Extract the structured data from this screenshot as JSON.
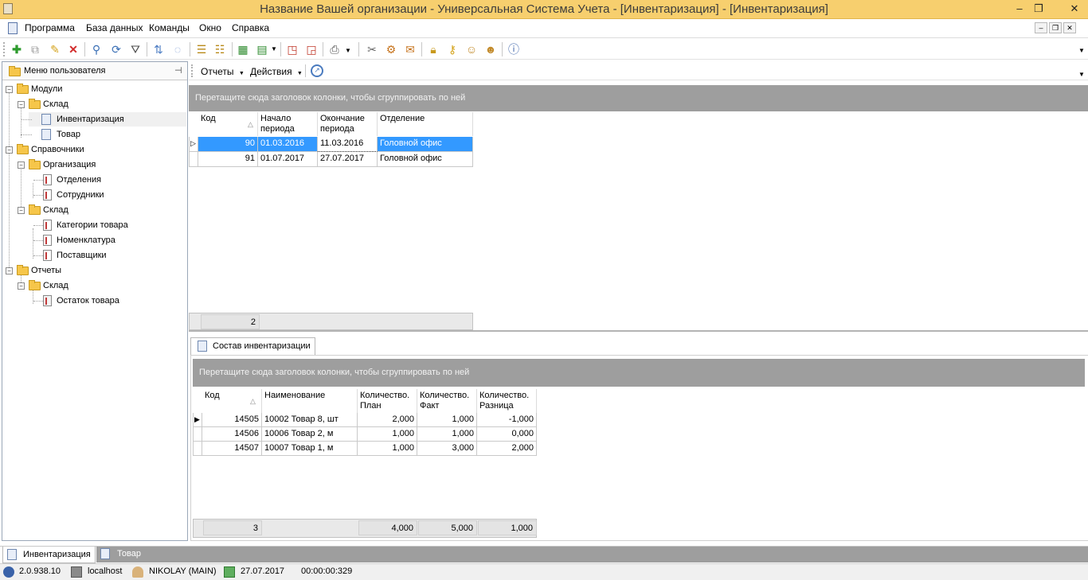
{
  "window": {
    "title": "Название Вашей организации - Универсальная Система Учета - [Инвентаризация] - [Инвентаризация]",
    "minimize": "‒",
    "restore": "❐",
    "close": "✕"
  },
  "menu": {
    "items": [
      "Программа",
      "База данных",
      "Команды",
      "Окно",
      "Справка"
    ]
  },
  "left_panel": {
    "title": "Меню пользователя",
    "pin": "⊣",
    "tree": [
      {
        "label": "Модули",
        "type": "folder"
      },
      {
        "label": "Склад",
        "type": "folder"
      },
      {
        "label": "Инвентаризация",
        "type": "doc"
      },
      {
        "label": "Товар",
        "type": "doc"
      },
      {
        "label": "Справочники",
        "type": "folder"
      },
      {
        "label": "Организация",
        "type": "folder"
      },
      {
        "label": "Отделения",
        "type": "ref"
      },
      {
        "label": "Сотрудники",
        "type": "ref"
      },
      {
        "label": "Склад",
        "type": "folder"
      },
      {
        "label": "Категории товара",
        "type": "ref"
      },
      {
        "label": "Номенклатура",
        "type": "ref"
      },
      {
        "label": "Поставщики",
        "type": "ref"
      },
      {
        "label": "Отчеты",
        "type": "folder"
      },
      {
        "label": "Склад",
        "type": "folder"
      },
      {
        "label": "Остаток товара",
        "type": "report"
      }
    ]
  },
  "sub_toolbar": {
    "reports": "Отчеты",
    "actions": "Действия"
  },
  "top_grid": {
    "group_hint": "Перетащите сюда заголовок колонки, чтобы сгруппировать по ней",
    "headers": [
      "Код",
      "Начало периода",
      "Окончание периода",
      "Отделение"
    ],
    "rows": [
      [
        "90",
        "01.03.2016",
        "11.03.2016",
        "Головной офис"
      ],
      [
        "91",
        "01.07.2017",
        "27.07.2017",
        "Головной офис"
      ]
    ],
    "footer_count": "2"
  },
  "detail_tab": {
    "label": "Состав инвентаризации"
  },
  "bottom_grid": {
    "group_hint": "Перетащите сюда заголовок колонки, чтобы сгруппировать по ней",
    "headers": [
      "Код",
      "Наименование",
      "Количество. План",
      "Количество. Факт",
      "Количество. Разница"
    ],
    "rows": [
      [
        "14505",
        "10002 Товар 8, шт",
        "2,000",
        "1,000",
        "-1,000"
      ],
      [
        "14506",
        "10006 Товар 2, м",
        "1,000",
        "1,000",
        "0,000"
      ],
      [
        "14507",
        "10007 Товар 1, м",
        "1,000",
        "3,000",
        "2,000"
      ]
    ],
    "footer": [
      "3",
      "4,000",
      "5,000",
      "1,000"
    ]
  },
  "window_tabs": [
    "Инвентаризация",
    "Товар"
  ],
  "status": {
    "version": "2.0.938.10",
    "server": "localhost",
    "user": "NIKOLAY (MAIN)",
    "date": "27.07.2017",
    "time": "00:00:00:329"
  }
}
